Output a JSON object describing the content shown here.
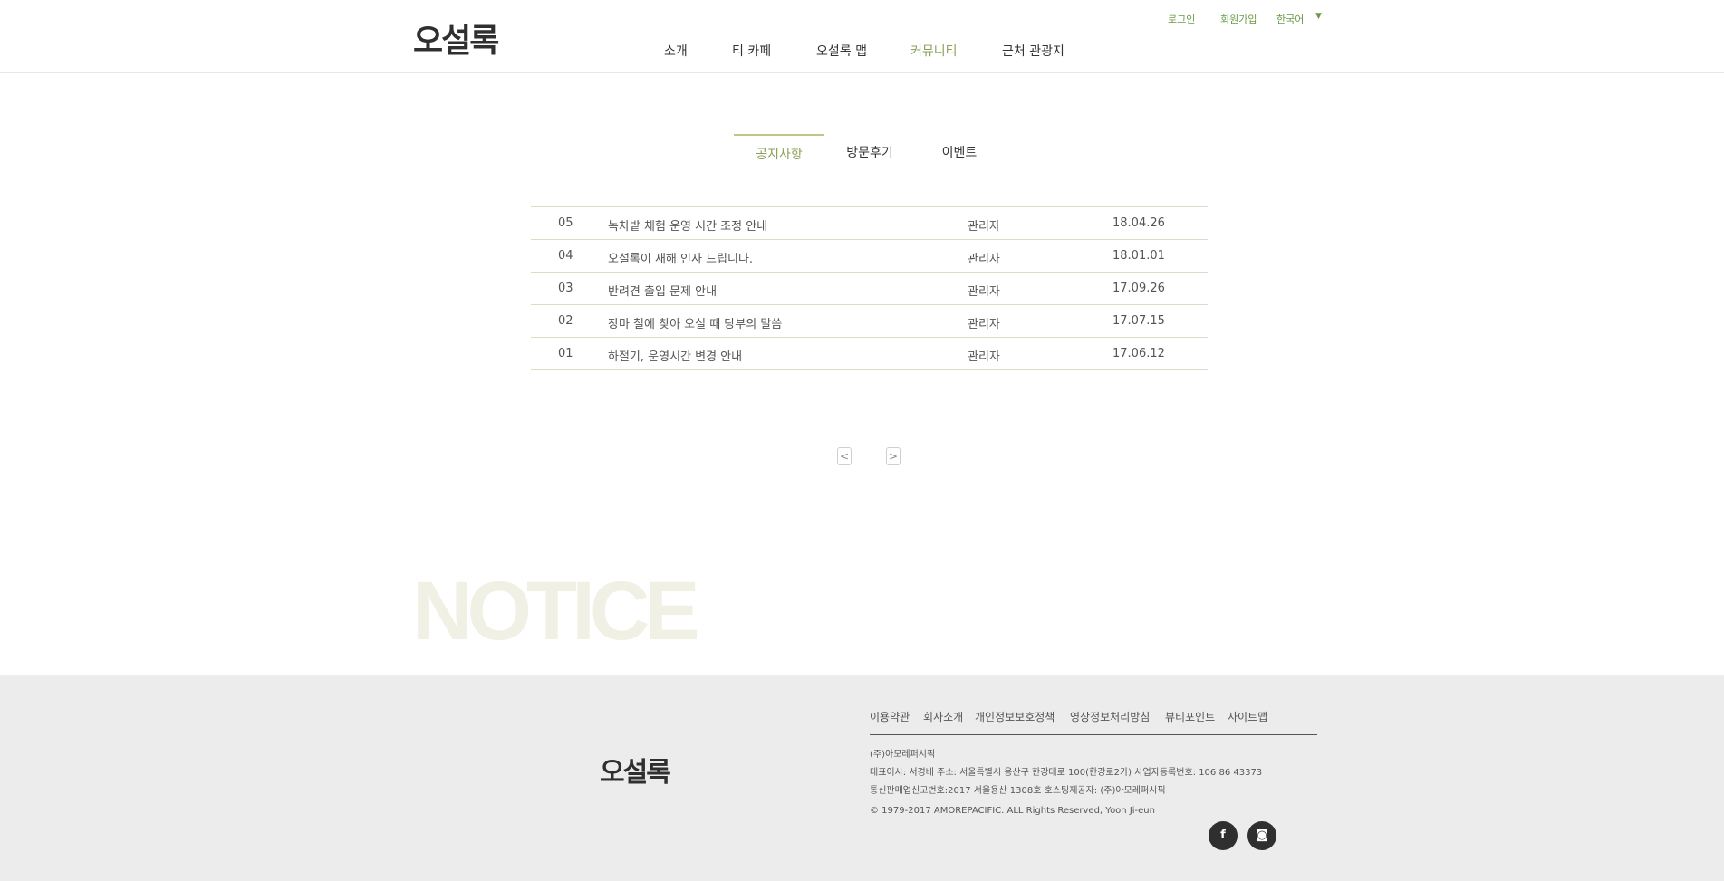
{
  "header": {
    "logo": "오설록",
    "nav": [
      "소개",
      "티 카페",
      "오설록 맵",
      "커뮤니티",
      "근처 관광지"
    ],
    "active_nav": "커뮤니티",
    "util": {
      "login": "로그인",
      "signup": "회원가입",
      "language": "한국어",
      "caret": "▼"
    }
  },
  "tabs": {
    "items": [
      "공지사항",
      "방문후기",
      "이벤트"
    ],
    "active": "공지사항"
  },
  "board": {
    "rows": [
      {
        "num": "05",
        "title": "녹차밭 체험 운영 시간 조정 안내",
        "writer": "관리자",
        "date": "18.04.26"
      },
      {
        "num": "04",
        "title": "오설록이 새해 인사 드립니다.",
        "writer": "관리자",
        "date": "18.01.01"
      },
      {
        "num": "03",
        "title": "반려견 출입 문제 안내",
        "writer": "관리자",
        "date": "17.09.26"
      },
      {
        "num": "02",
        "title": "장마 철에 찾아 오실 때 당부의 말씀",
        "writer": "관리자",
        "date": "17.07.15"
      },
      {
        "num": "01",
        "title": "하절기, 운영시간 변경 안내",
        "writer": "관리자",
        "date": "17.06.12"
      }
    ]
  },
  "pager": {
    "prev": "<",
    "next": ">"
  },
  "watermark": "NOTICE",
  "footer": {
    "logo": "오설록",
    "links": [
      "이용약관",
      "회사소개",
      "개인정보보호정책",
      "영상정보처리방침",
      "뷰티포인트",
      "사이트맵"
    ],
    "company": "(주)아모레퍼시픽",
    "info1": "대표이사: 서경배  주소: 서울특별시 용산구 한강대로 100(한강로2가)  사업자등록번호: 106 86 43373",
    "info2": "통신판매업신고번호:2017 서울용산 1308호  호스팅제공자: (주)아모레퍼시픽",
    "copyright": "© 1979-2017 AMOREPACIFIC. ALL Rights Reserved, Yoon Ji-eun",
    "social": [
      {
        "icon": "facebook-icon",
        "glyph": "f"
      },
      {
        "icon": "instagram-icon",
        "glyph": "◙"
      }
    ]
  },
  "colors": {
    "accent": "#8aa05a",
    "util_green": "#6a9a48",
    "footer_bg": "#ececec",
    "watermark": "#f0f0e4"
  }
}
